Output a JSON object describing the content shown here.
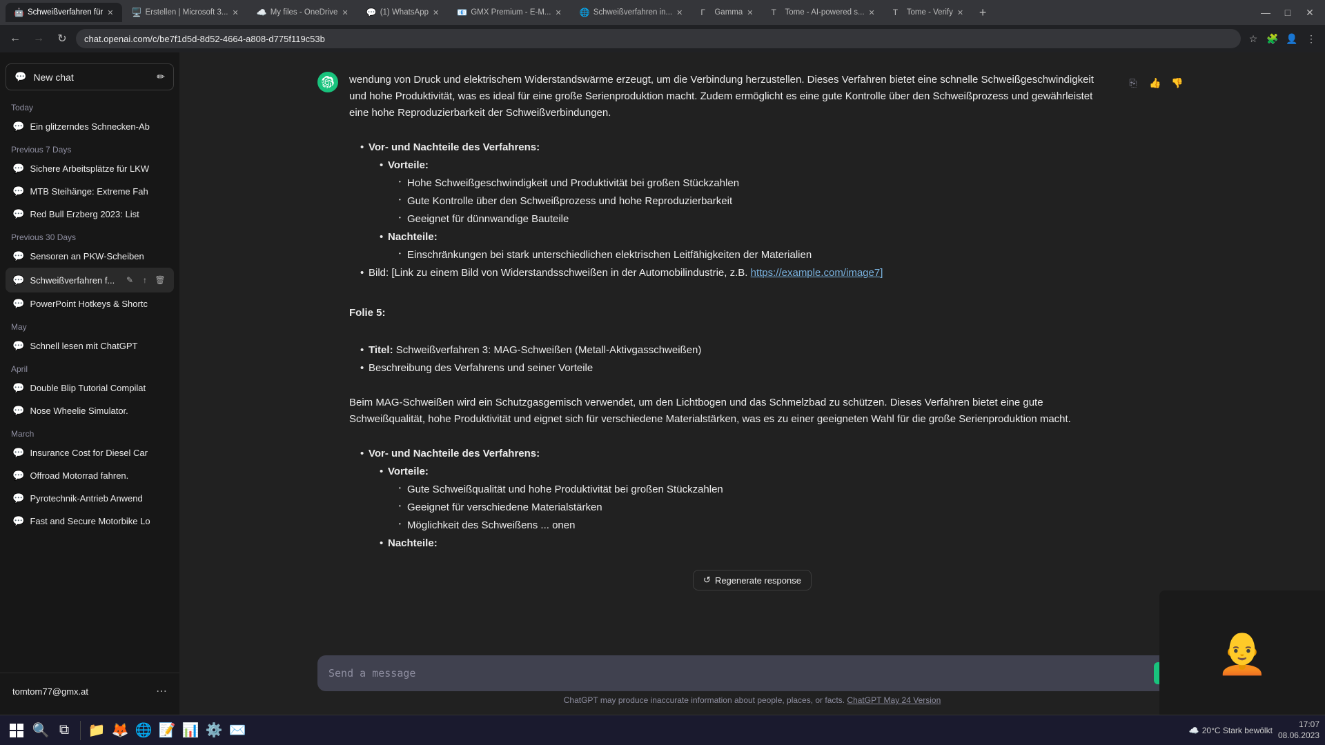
{
  "browser": {
    "address": "chat.openai.com/c/be7f1d5d-8d52-4664-a808-d775f119c53b",
    "tabs": [
      {
        "id": "tab1",
        "label": "Schweißverfahren für",
        "active": true,
        "favicon": "🤖"
      },
      {
        "id": "tab2",
        "label": "Erstellen | Microsoft 3...",
        "active": false,
        "favicon": "🖥️"
      },
      {
        "id": "tab3",
        "label": "My files - OneDrive",
        "active": false,
        "favicon": "☁️"
      },
      {
        "id": "tab4",
        "label": "(1) WhatsApp",
        "active": false,
        "favicon": "💬"
      },
      {
        "id": "tab5",
        "label": "GMX Premium - E-M...",
        "active": false,
        "favicon": "📧"
      },
      {
        "id": "tab6",
        "label": "Schweißverfahren in...",
        "active": false,
        "favicon": "🌐"
      },
      {
        "id": "tab7",
        "label": "Gamma",
        "active": false,
        "favicon": "Γ"
      },
      {
        "id": "tab8",
        "label": "Tome - AI-powered s...",
        "active": false,
        "favicon": "T"
      },
      {
        "id": "tab9",
        "label": "Tome - Verify",
        "active": false,
        "favicon": "T"
      }
    ]
  },
  "sidebar": {
    "new_chat_label": "New chat",
    "sections": [
      {
        "label": "Today",
        "items": [
          {
            "id": "c1",
            "label": "Ein glitzerndes Schnecken-Ab"
          }
        ]
      },
      {
        "label": "Previous 7 Days",
        "items": [
          {
            "id": "c2",
            "label": "Sichere Arbeitsplätze für LKW"
          },
          {
            "id": "c3",
            "label": "MTB Steihänge: Extreme Fah"
          },
          {
            "id": "c4",
            "label": "Red Bull Erzberg 2023: List"
          }
        ]
      },
      {
        "label": "Previous 30 Days",
        "items": [
          {
            "id": "c5",
            "label": "Sensoren an PKW-Scheiben"
          },
          {
            "id": "c6",
            "label": "Schweißverfahren f...",
            "active": true
          }
        ]
      },
      {
        "label": "",
        "items": [
          {
            "id": "c7",
            "label": "PowerPoint Hotkeys & Shortc"
          }
        ]
      },
      {
        "label": "May",
        "items": [
          {
            "id": "c8",
            "label": "Schnell lesen mit ChatGPT"
          }
        ]
      },
      {
        "label": "April",
        "items": [
          {
            "id": "c9",
            "label": "Double Blip Tutorial Compilat"
          },
          {
            "id": "c10",
            "label": "Nose Wheelie Simulator."
          }
        ]
      },
      {
        "label": "March",
        "items": [
          {
            "id": "c11",
            "label": "Insurance Cost for Diesel Car"
          },
          {
            "id": "c12",
            "label": "Offroad Motorrad fahren."
          },
          {
            "id": "c13",
            "label": "Pyrotechnik-Antrieb Anwend"
          },
          {
            "id": "c14",
            "label": "Fast and Secure Motorbike Lo"
          }
        ]
      }
    ],
    "user_email": "tomtom77@gmx.at"
  },
  "chat": {
    "paragraphs": [
      "wendung von Druck und elektrischem Widerstandswärme erzeugt, um die Verbindung herzustellen. Dieses Verfahren bietet eine schnelle Schweißgeschwindigkeit und hohe Produktivität, was es ideal für eine große Serienproduktion macht. Zudem ermöglicht es eine gute Kontrolle über den Schweißprozess und gewährleistet eine hohe Reproduzierbarkeit der Schweißverbindungen."
    ],
    "vorNachteile_title": "Vor- und Nachteile des Verfahrens:",
    "vorteile_title": "Vorteile:",
    "vorteile": [
      "Hohe Schweißgeschwindigkeit und Produktivität bei großen Stückzahlen",
      "Gute Kontrolle über den Schweißprozess und hohe Reproduzierbarkeit",
      "Geeignet für dünnwandige Bauteile"
    ],
    "nachteile_title": "Nachteile:",
    "nachteile": [
      "Einschränkungen bei stark unterschiedlichen elektrischen Leitfähigkeiten der Materialien"
    ],
    "bild_label": "Bild: [Link zu einem Bild von Widerstandsschweißen in der Automobilindustrie, z.B.",
    "bild_link": "https://example.com/image7]",
    "folie5_title": "Folie 5:",
    "folie5_items": [
      {
        "label": "Titel:",
        "text": "Schweißverfahren 3: MAG-Schweißen (Metall-Aktivgasschweißen)"
      },
      {
        "label": "Beschreibung des Verfahrens und seiner Vorteile"
      }
    ],
    "mag_description": "Beim MAG-Schweißen wird ein Schutzgasgemisch verwendet, um den Lichtbogen und das Schmelzbad zu schützen. Dieses Verfahren bietet eine gute Schweißqualität, hohe Produktivität und eignet sich für verschiedene Materialstärken, was es zu einer geeigneten Wahl für die große Serienproduktion macht.",
    "mag_vorNachteile_title": "Vor- und Nachteile des Verfahrens:",
    "mag_vorteile_title": "Vorteile:",
    "mag_vorteile": [
      "Gute Schweißqualität und hohe Produktivität bei großen Stückzahlen",
      "Geeignet für verschiedene Materialstärken",
      "Möglichkeit des Schweißens ... onen"
    ],
    "mag_nachteile_title": "Nachteile:",
    "regenerate_label": "Regenerate response",
    "input_placeholder": "Send a message",
    "disclaimer": "ChatGPT may produce inaccurate information about people, places, or facts.",
    "disclaimer_link": "ChatGPT May 24 Version"
  },
  "taskbar": {
    "weather": "20°C  Stark bewölkt",
    "time_line1": "17:07",
    "time_line2": "08.06.2023"
  },
  "icons": {
    "chat_icon": "💬",
    "pencil_icon": "✏",
    "thumbs_up": "👍",
    "thumbs_down": "👎",
    "copy_icon": "⎘",
    "send_icon": "➤",
    "menu_icon": "⋯",
    "regen_icon": "↺",
    "edit_icon": "✎",
    "share_icon": "↑",
    "trash_icon": "🗑",
    "windows_icon": "⊞",
    "search_icon": "🔍",
    "user_icon": "👤"
  }
}
